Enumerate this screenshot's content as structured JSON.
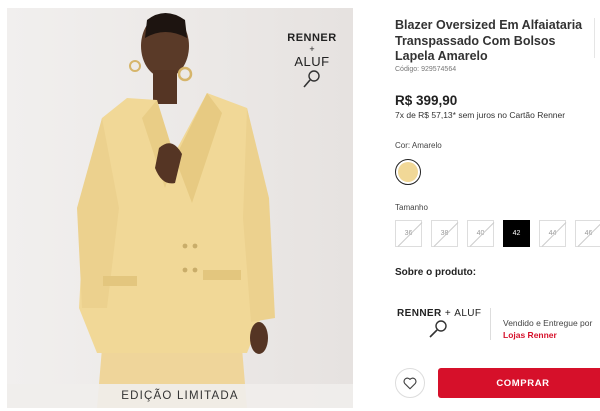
{
  "product": {
    "title": "Blazer Oversized Em Alfaiataria Transpassado Com Bolsos Lapela Amarelo",
    "sku": "Código: 929574564",
    "price": "R$ 399,90",
    "installments": "7x de R$ 57,13* sem juros no Cartão Renner"
  },
  "image": {
    "brand_renner": "RENNER",
    "brand_plus": "+",
    "brand_aluf": "ALUF",
    "limited_label": "EDIÇÃO LIMITADA"
  },
  "color": {
    "label": "Cor: Amarelo",
    "swatch_hex": "#f1d897"
  },
  "size": {
    "label": "Tamanho",
    "options": [
      {
        "label": "36",
        "state": "unavailable"
      },
      {
        "label": "38",
        "state": "unavailable"
      },
      {
        "label": "40",
        "state": "unavailable"
      },
      {
        "label": "42",
        "state": "selected"
      },
      {
        "label": "44",
        "state": "unavailable"
      },
      {
        "label": "46",
        "state": "unavailable"
      }
    ]
  },
  "about": {
    "heading": "Sobre o produto:",
    "logo_renner": "RENNER",
    "logo_plus": "+",
    "logo_aluf": "ALUF",
    "sold_by": "Vendido e Entregue por",
    "store": "Lojas Renner"
  },
  "actions": {
    "favorite_icon": "heart-icon",
    "buy_label": "COMPRAR"
  },
  "colors": {
    "accent": "#d6102a",
    "blazer": "#f1d897"
  }
}
